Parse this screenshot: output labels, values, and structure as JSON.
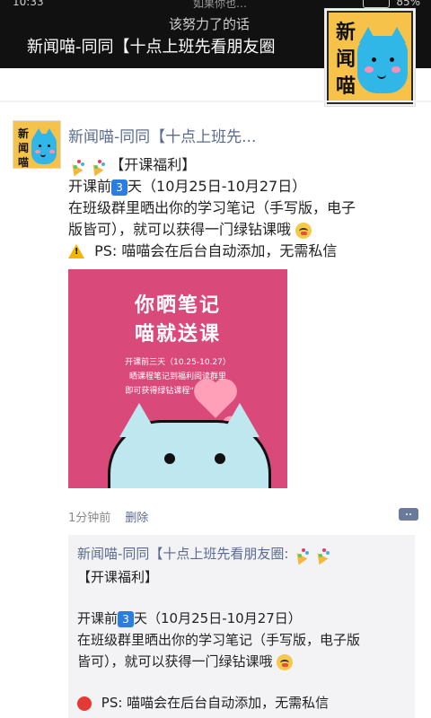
{
  "status_bar": {
    "time": "10:33",
    "carrier_fragment": "如果你也…",
    "battery": "85%"
  },
  "header": {
    "subtitle": "该努力了的话",
    "title": "新闻喵-同同【十点上班先看朋友圈"
  },
  "cover_avatar": {
    "text_chars": [
      "新",
      "闻",
      "喵"
    ]
  },
  "post": {
    "author": "新闻喵-同同【十点上班先...",
    "line1": "【开课福利】",
    "line2_prefix": "开课前",
    "line2_num": "3",
    "line2_suffix": "天（10月25日-10月27日）",
    "line3": "在班级群里晒出你的学习笔记（手写版，电子",
    "line4": "版皆可），就可以获得一门绿钻课哦",
    "line5": "PS: 喵喵会在后台自动添加，无需私信",
    "poster": {
      "title1": "你晒笔记",
      "title2": "喵就送课",
      "desc1": "开课前三天（10.25-10.27）",
      "desc2": "晒课程笔记到福利阅读群里",
      "desc3": "即可获得绿钻课程“美式中餐”"
    },
    "meta": {
      "time": "1分钟前",
      "delete": "删除"
    }
  },
  "quoted": {
    "line1": "新闻喵-同同【十点上班先看朋友圈:",
    "line2": "【开课福利】",
    "line3_prefix": "开课前",
    "line3_num": "3",
    "line3_suffix": "天（10月25日-10月27日）",
    "line4": "在班级群里晒出你的学习笔记（手写版，电子版",
    "line5": "皆可），就可以获得一门绿钻课哦",
    "line6": "PS: 喵喵会在后台自动添加，无需私信"
  }
}
